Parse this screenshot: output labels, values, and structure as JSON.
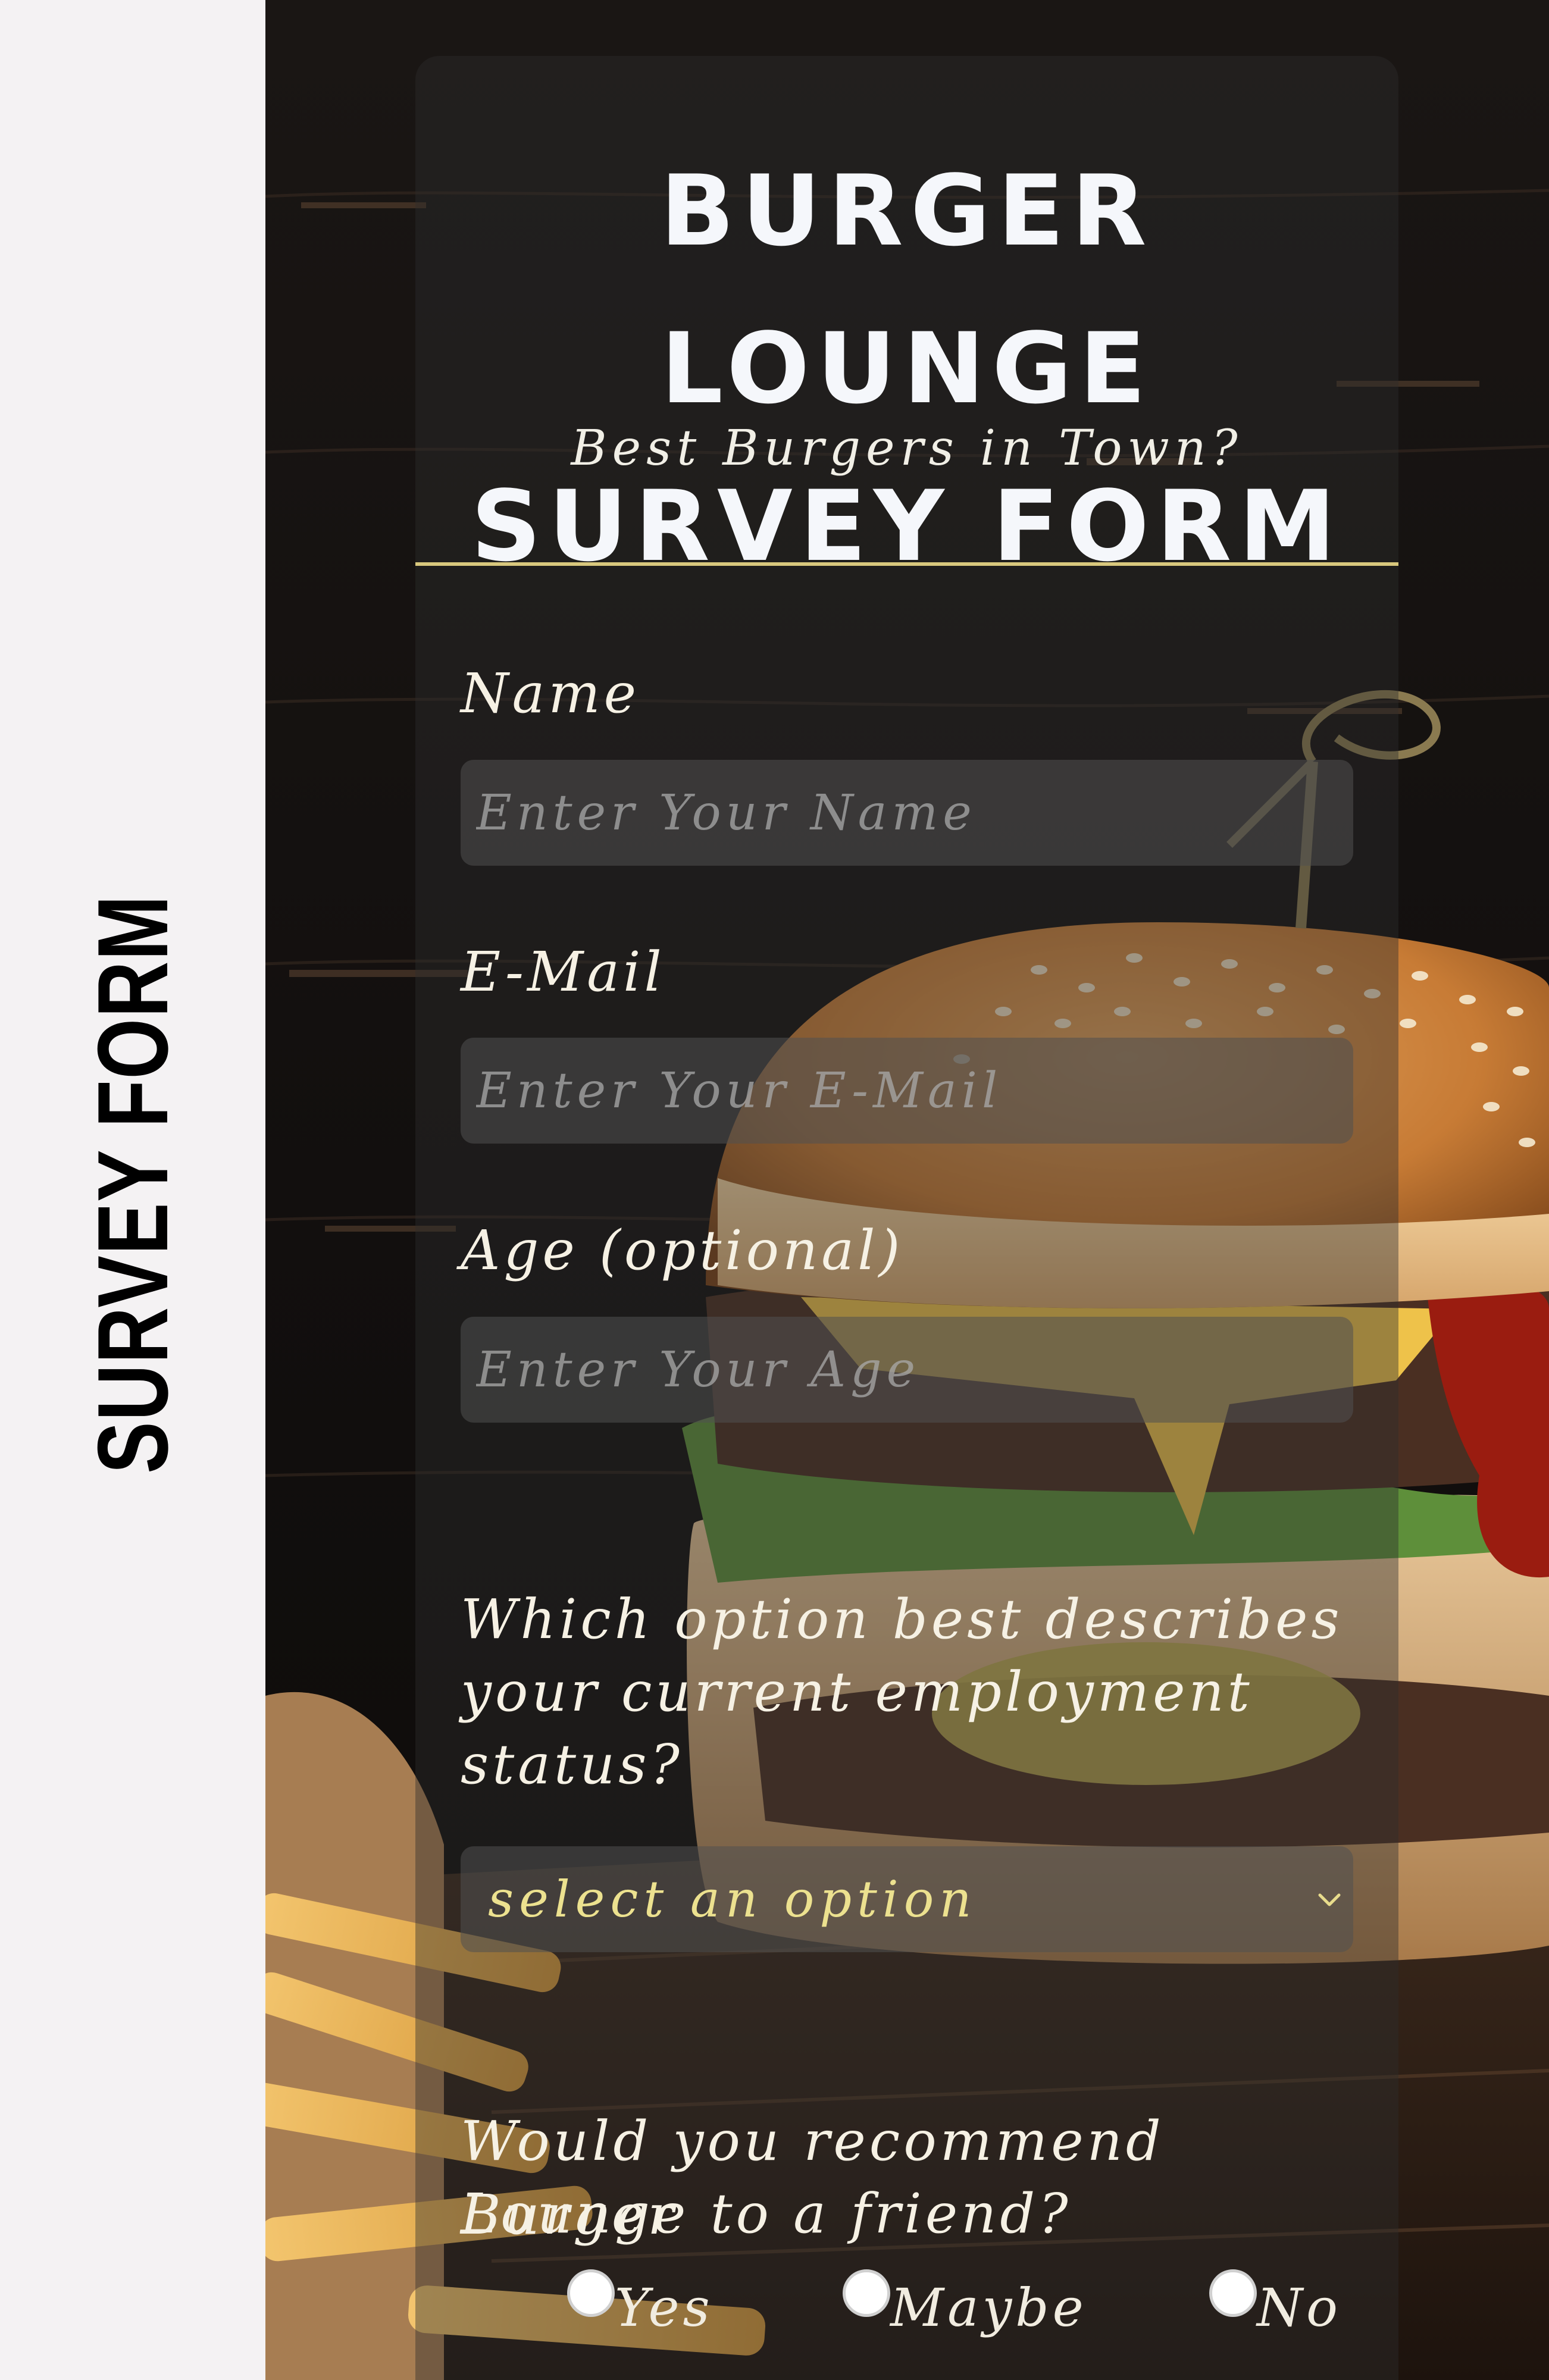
{
  "sidebar": {
    "title": "SURVEY FORM"
  },
  "header": {
    "title_line1": "BURGER LOUNGE",
    "title_line2": "SURVEY FORM",
    "subtitle": "Best Burgers in Town?"
  },
  "form": {
    "name": {
      "label": "Name",
      "placeholder": "Enter Your Name"
    },
    "email": {
      "label": "E-Mail",
      "placeholder": "Enter Your E-Mail"
    },
    "age": {
      "label": "Age (optional)",
      "placeholder": "Enter Your Age"
    },
    "employment": {
      "question_line1": "Which option best describes",
      "question_line2": "your current employment",
      "question_line3": "status?",
      "selected_value": "select an option"
    },
    "recommend": {
      "question_line1": "Would you recommend Burger",
      "question_line2": "Lounge to a friend?",
      "options": [
        "Yes",
        "Maybe",
        "No"
      ]
    }
  },
  "colors": {
    "accent_line": "#d8c87d",
    "select_text": "#ece18f",
    "card_bg": "rgba(45,45,45,0.42)"
  },
  "icons": {
    "select_arrow": "chevron-down-icon"
  }
}
